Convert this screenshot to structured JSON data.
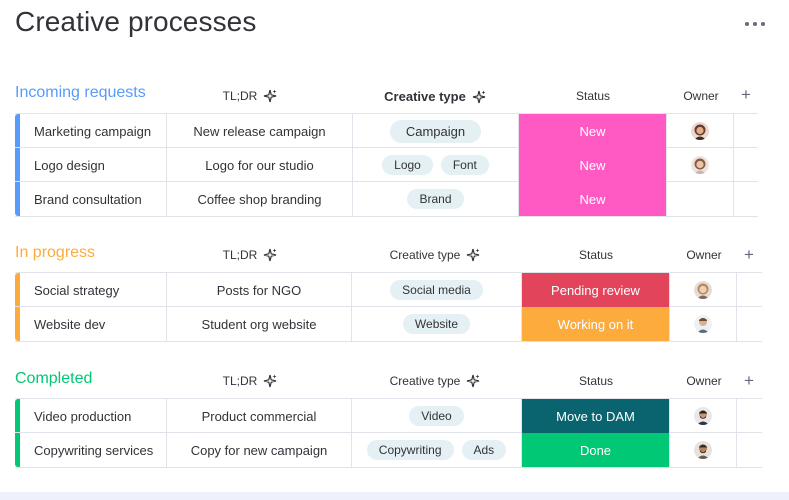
{
  "page": {
    "title": "Creative processes"
  },
  "columns": {
    "tldr": "TL;DR",
    "creative_type": "Creative type",
    "status": "Status",
    "owner": "Owner"
  },
  "colors": {
    "new": "#ff5ac4",
    "pending_review": "#e2445c",
    "working_on_it": "#fdab3d",
    "move_to_dam": "#0a6470",
    "done": "#00c875",
    "incoming_accent": "#579bfc",
    "progress_accent": "#fdab3d",
    "completed_accent": "#00c875"
  },
  "groups": [
    {
      "title": "Incoming requests",
      "rows": [
        {
          "name": "Marketing campaign",
          "tldr": "New release campaign",
          "types": [
            "Campaign"
          ],
          "status": "New",
          "owner_icon": "woman-avatar-icon"
        },
        {
          "name": "Logo design",
          "tldr": "Logo for our studio",
          "types": [
            "Logo",
            "Font"
          ],
          "status": "New",
          "owner_icon": "woman-avatar-icon"
        },
        {
          "name": "Brand consultation",
          "tldr": "Coffee shop branding",
          "types": [
            "Brand"
          ],
          "status": "New",
          "owner_icon": ""
        }
      ]
    },
    {
      "title": "In progress",
      "rows": [
        {
          "name": "Social strategy",
          "tldr": "Posts for NGO",
          "types": [
            "Social media"
          ],
          "status": "Pending review",
          "owner_icon": "woman-avatar-icon"
        },
        {
          "name": "Website dev",
          "tldr": "Student org website",
          "types": [
            "Website"
          ],
          "status": "Working on it",
          "owner_icon": "man-avatar-icon"
        }
      ]
    },
    {
      "title": "Completed",
      "rows": [
        {
          "name": "Video production",
          "tldr": "Product commercial",
          "types": [
            "Video"
          ],
          "status": "Move to DAM",
          "owner_icon": "man-avatar-icon"
        },
        {
          "name": "Copywriting services",
          "tldr": "Copy for new campaign",
          "types": [
            "Copywriting",
            "Ads"
          ],
          "status": "Done",
          "owner_icon": "man-avatar-icon"
        }
      ]
    }
  ]
}
